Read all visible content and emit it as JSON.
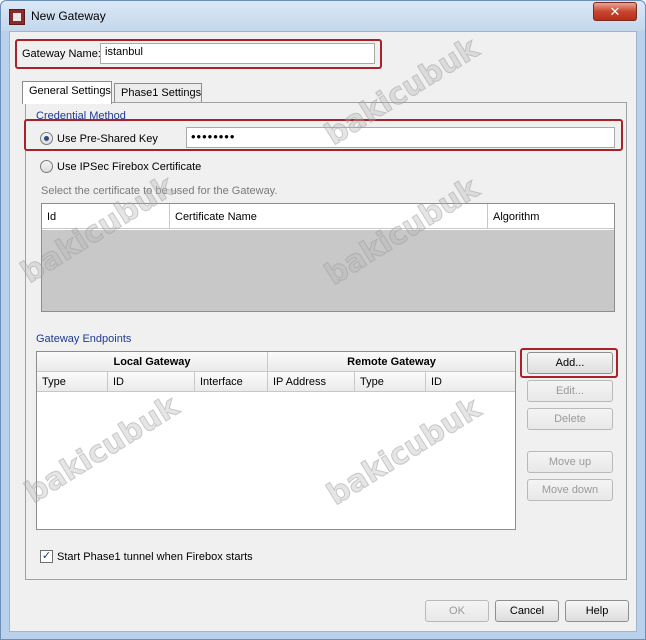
{
  "window": {
    "title": "New Gateway",
    "close_glyph": "✕"
  },
  "gateway_name": {
    "label": "Gateway Name:",
    "value": "istanbul"
  },
  "tabs": [
    {
      "label": "General Settings"
    },
    {
      "label": "Phase1 Settings"
    }
  ],
  "credential": {
    "section_title": "Credential Method",
    "psk_label": "Use Pre-Shared Key",
    "psk_value": "••••••••",
    "cert_label": "Use IPSec Firebox Certificate",
    "cert_hint": "Select the certificate to be used for the Gateway.",
    "cert_columns": [
      "Id",
      "Certificate Name",
      "Algorithm"
    ]
  },
  "endpoints": {
    "section_title": "Gateway Endpoints",
    "local_group": "Local Gateway",
    "remote_group": "Remote Gateway",
    "columns": [
      "Type",
      "ID",
      "Interface",
      "IP Address",
      "Type",
      "ID"
    ]
  },
  "side_buttons": {
    "add": "Add...",
    "edit": "Edit...",
    "delete": "Delete",
    "move_up": "Move up",
    "move_down": "Move down"
  },
  "start_phase1": "Start Phase1 tunnel when Firebox starts",
  "dialog_buttons": {
    "ok": "OK",
    "cancel": "Cancel",
    "help": "Help"
  },
  "watermark": "bakicubuk"
}
